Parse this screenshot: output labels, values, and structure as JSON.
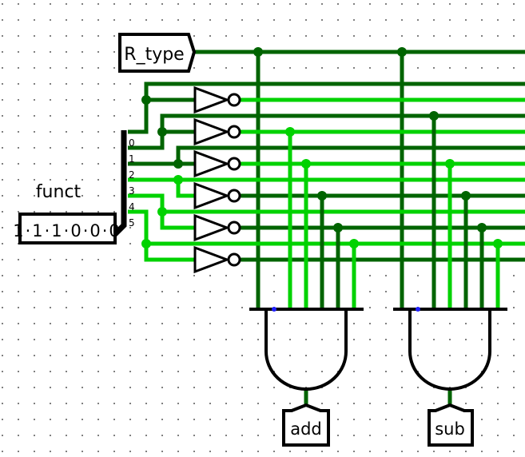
{
  "colors": {
    "wire_low": "#006400",
    "wire_high": "#00d200",
    "unconnected": "#2020ff",
    "component": "#000000",
    "grid_dot": "#808080"
  },
  "tunnel": {
    "label": "R_type",
    "value": 0
  },
  "input": {
    "label": "funct",
    "value": "111000"
  },
  "splitter": {
    "bit_labels": [
      "0",
      "1",
      "2",
      "3",
      "4",
      "5"
    ]
  },
  "not_gates": [
    {
      "bit": 0,
      "output": 1
    },
    {
      "bit": 1,
      "output": 1
    },
    {
      "bit": 2,
      "output": 1
    },
    {
      "bit": 3,
      "output": 0
    },
    {
      "bit": 4,
      "output": 0
    },
    {
      "bit": 5,
      "output": 0
    }
  ],
  "outputs": [
    {
      "label": "add",
      "value": 0
    },
    {
      "label": "sub",
      "value": 0
    }
  ]
}
